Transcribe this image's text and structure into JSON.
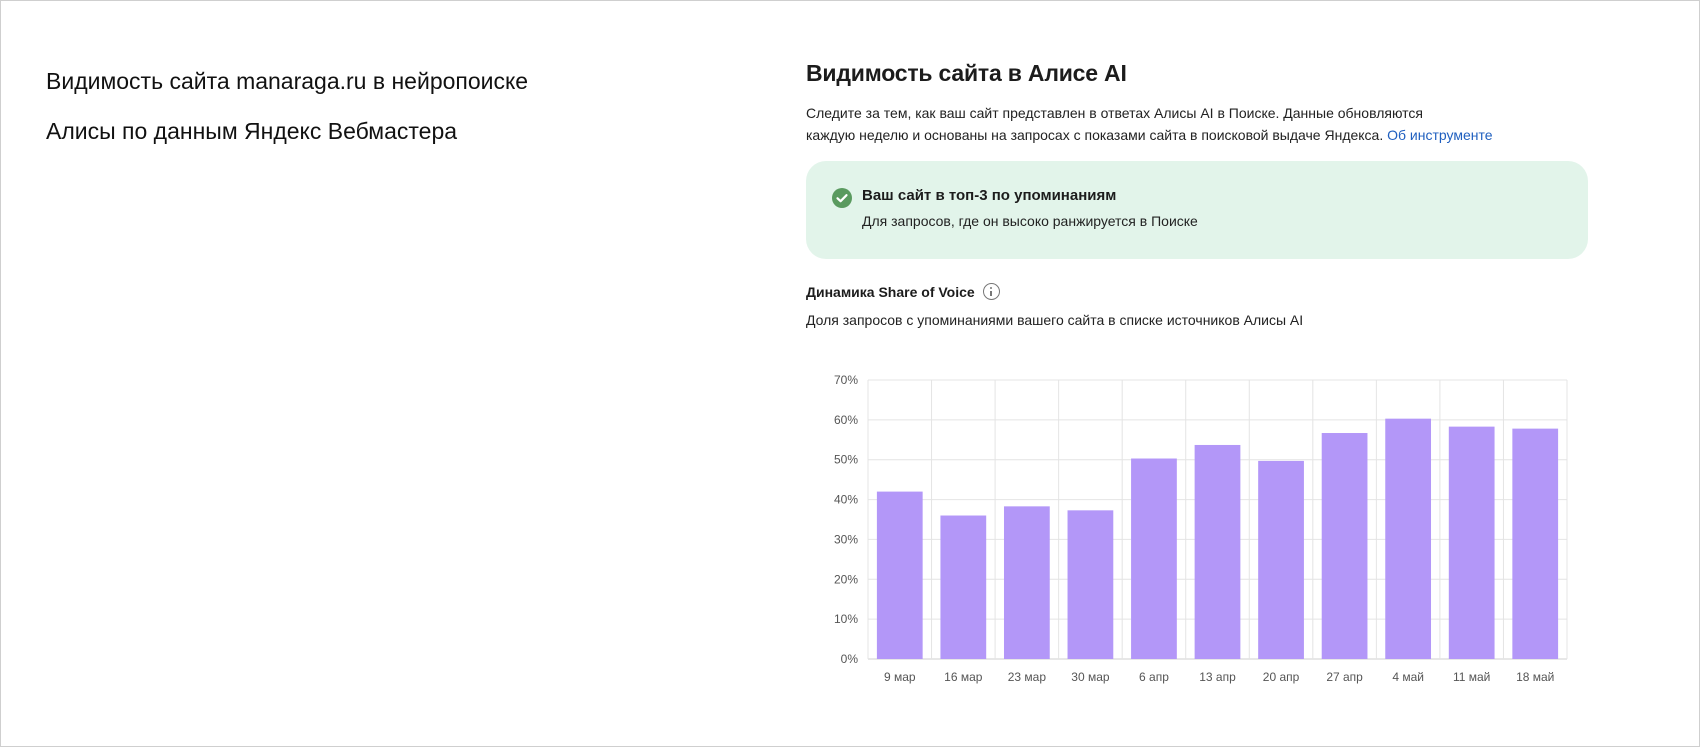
{
  "caption": {
    "line1": "Видимость сайта manaraga.ru в нейропоиске",
    "line2": "Алисы по данным Яндекс Вебмастера"
  },
  "panel": {
    "title": "Видимость сайта в Алисе AI",
    "desc_line1": "Следите за тем, как ваш сайт представлен в ответах Алисы AI в Поиске. Данные обновляются",
    "desc_line2": "каждую неделю и основаны на запросах с показами сайта в поисковой выдаче Яндекса.",
    "desc_link": "Об инструменте"
  },
  "notice": {
    "icon": "check-circle-icon",
    "title": "Ваш сайт в топ-3 по упоминаниям",
    "subtitle": "Для запросов, где он высоко ранжируется в Поиске",
    "bg_color": "#e2f4ea",
    "icon_color": "#5a9a5f"
  },
  "sov": {
    "title": "Динамика Share of Voice",
    "info_icon": "info-icon",
    "subtitle": "Доля запросов с упоминаниями вашего сайта в списке источников Алисы AI"
  },
  "chart_data": {
    "type": "bar",
    "categories": [
      "9 мар",
      "16 мар",
      "23 мар",
      "30 мар",
      "6 апр",
      "13 апр",
      "20 апр",
      "27 апр",
      "4 май",
      "11 май",
      "18 май"
    ],
    "values": [
      42,
      36,
      38.3,
      37.3,
      50.3,
      53.7,
      49.7,
      56.7,
      60.3,
      58.3,
      57.8
    ],
    "ylim": [
      0,
      70
    ],
    "yticks": [
      "0%",
      "10%",
      "20%",
      "30%",
      "40%",
      "50%",
      "60%",
      "70%"
    ],
    "grid": true,
    "bar_color": "#b397f8"
  }
}
